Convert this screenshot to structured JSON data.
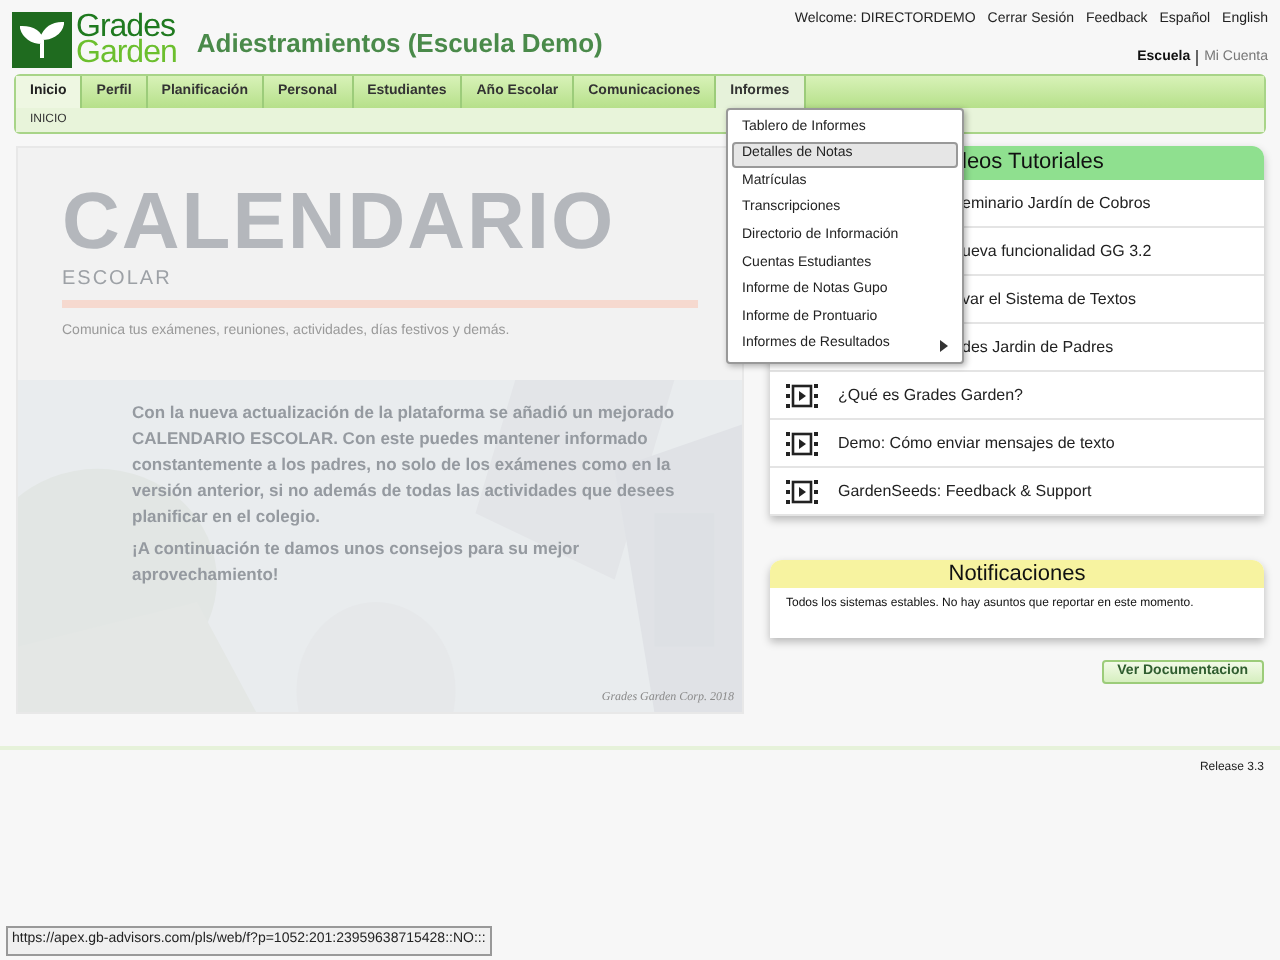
{
  "logo": {
    "line1": "Grades",
    "line2": "Garden"
  },
  "site_title": "Adiestramientos (Escuela Demo)",
  "top_links": [
    "Welcome: DIRECTORDEMO",
    "Cerrar Sesión",
    "Feedback",
    "Español",
    "English"
  ],
  "account_links": [
    {
      "label": "Escuela",
      "selected": true
    },
    {
      "label": "Mi Cuenta",
      "selected": false
    }
  ],
  "tabs": [
    {
      "label": "Inicio",
      "selected": true
    },
    {
      "label": "Perfil",
      "selected": false
    },
    {
      "label": "Planificación",
      "selected": false
    },
    {
      "label": "Personal",
      "selected": false
    },
    {
      "label": "Estudiantes",
      "selected": false
    },
    {
      "label": "Año Escolar",
      "selected": false
    },
    {
      "label": "Comunicaciones",
      "selected": false
    },
    {
      "label": "Informes",
      "selected": false,
      "open": true
    }
  ],
  "breadcrumb": "INICIO",
  "banner": {
    "title": "CALENDARIO",
    "subtitle": "ESCOLAR",
    "tagline": "Comunica tus exámenes, reuniones, actividades, días festivos y demás.",
    "body": "Con la nueva actualización de la plataforma se añadió un mejorado CALENDARIO ESCOLAR. Con este puedes mantener informado constantemente a los padres, no solo de los exámenes como en la versión anterior, si no además de todas las actividades que desees planificar en el colegio.",
    "closing": "¡A continuación te damos unos consejos para su mejor aprovechamiento!",
    "credit": "Grades Garden Corp. 2018"
  },
  "dropdown": [
    {
      "label": "Tablero de Informes",
      "selected": false
    },
    {
      "label": "Detalles de Notas",
      "selected": true
    },
    {
      "label": "Matrículas",
      "selected": false
    },
    {
      "label": "Transcripciones",
      "selected": false
    },
    {
      "label": "Directorio de Información",
      "selected": false
    },
    {
      "label": "Cuentas Estudiantes",
      "selected": false
    },
    {
      "label": "Informe de Notas Gupo",
      "selected": false
    },
    {
      "label": "Informe de Prontuario",
      "selected": false
    },
    {
      "label": "Informes de Resultados",
      "selected": false,
      "submenu": true
    }
  ],
  "videos": {
    "title": "leos Tutoriales",
    "items": [
      {
        "label": "eminario Jardín de Cobros",
        "covered": true
      },
      {
        "label": "ueva funcionalidad GG 3.2",
        "covered": true
      },
      {
        "label": "var el Sistema de Textos",
        "covered": true
      },
      {
        "label": "des Jardin de Padres",
        "covered": true
      },
      {
        "label": "¿Qué es Grades Garden?",
        "covered": false
      },
      {
        "label": "Demo: Cómo enviar mensajes de texto",
        "covered": false
      },
      {
        "label": "GardenSeeds: Feedback & Support",
        "covered": false
      }
    ]
  },
  "notifications": {
    "title": "Notificaciones",
    "message": "Todos los sistemas estables. No hay asuntos que reportar en este momento."
  },
  "doc_button": "Ver Documentacion",
  "release": "Release 3.3",
  "status_url": "https://apex.gb-advisors.com/pls/web/f?p=1052:201:23959638715428::NO:::"
}
